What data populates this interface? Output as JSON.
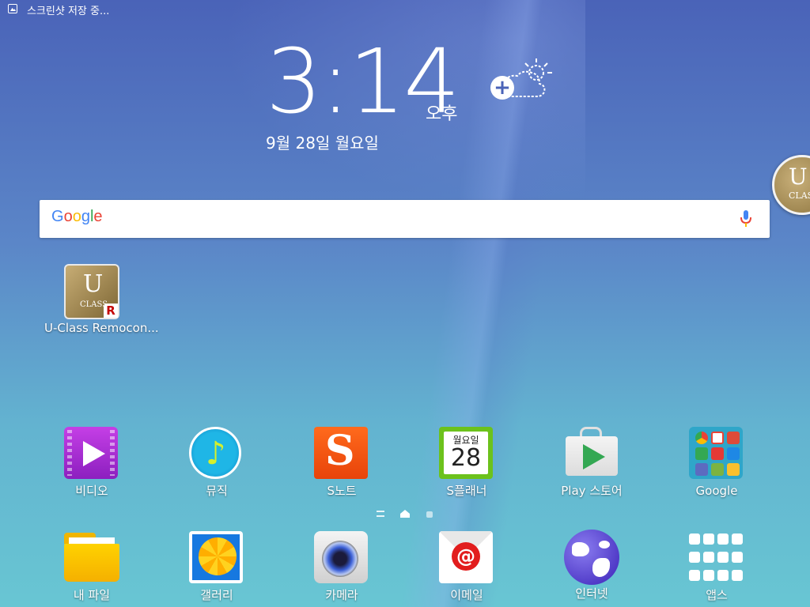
{
  "status_bar": {
    "notification": "스크린샷 저장 중..."
  },
  "clock": {
    "time": "3:14",
    "ampm": "오후",
    "date": "9월 28일 월요일"
  },
  "search": {
    "logo": "Google"
  },
  "widgets": {
    "side_label_u": "U",
    "side_label_class": "CLASS"
  },
  "desktop_apps": [
    {
      "label": "U-Class Remocon..."
    }
  ],
  "apps_row1": [
    {
      "label": "비디오"
    },
    {
      "label": "뮤직"
    },
    {
      "label": "S노트"
    },
    {
      "label": "S플래너",
      "day_name": "월요일",
      "day_number": "28"
    },
    {
      "label": "Play 스토어"
    },
    {
      "label": "Google"
    }
  ],
  "dock": [
    {
      "label": "내 파일"
    },
    {
      "label": "갤러리"
    },
    {
      "label": "카메라"
    },
    {
      "label": "이메일"
    },
    {
      "label": "인터넷"
    },
    {
      "label": "앱스"
    }
  ],
  "colors": {
    "google_blue": "#4285f4",
    "google_red": "#ea4335",
    "google_yellow": "#fbbc05",
    "google_green": "#34a853"
  }
}
